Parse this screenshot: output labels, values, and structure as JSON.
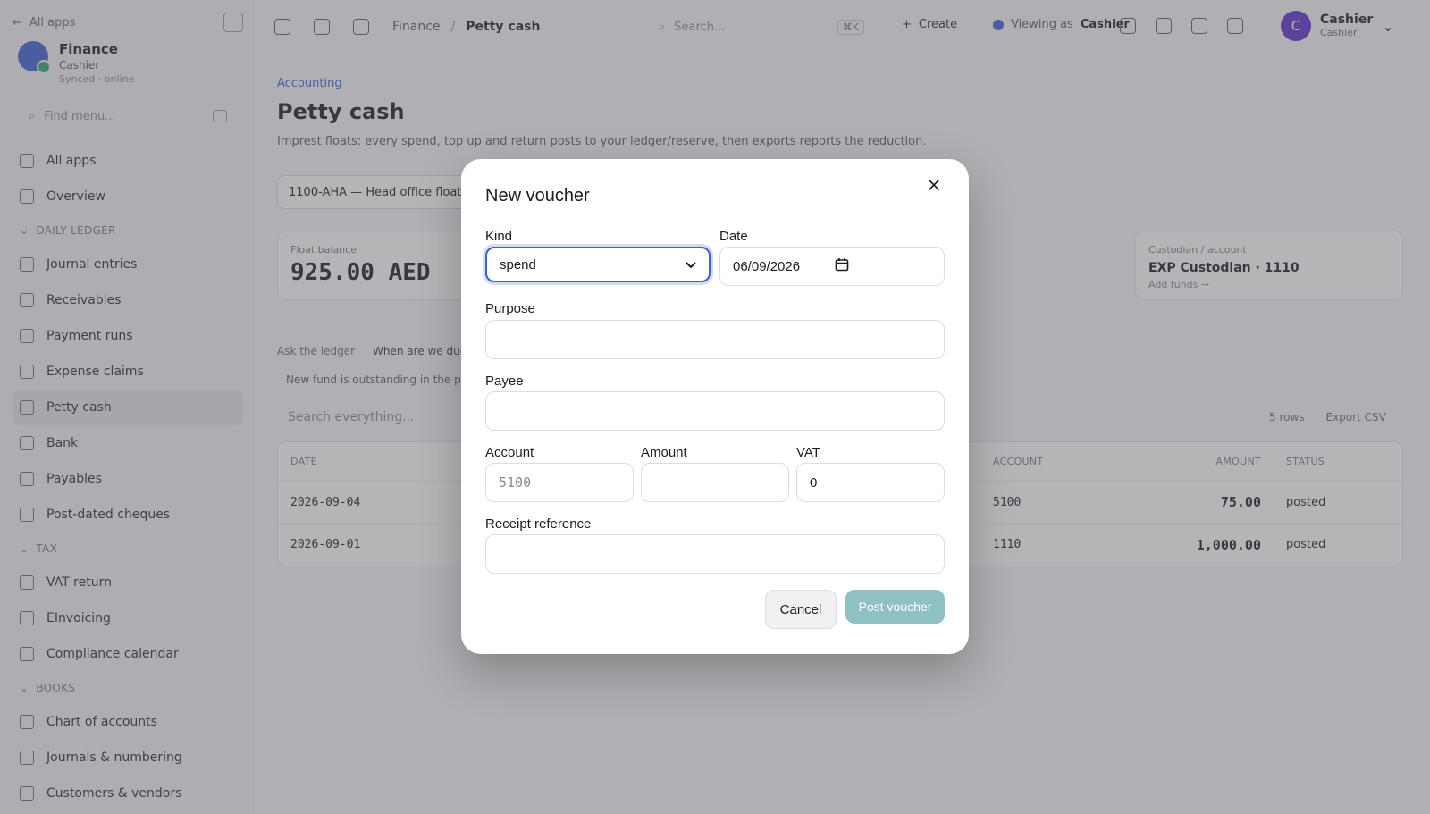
{
  "sidebar": {
    "all_apps": "All apps",
    "app": {
      "name": "Finance",
      "subtitle": "Cashier",
      "status": "Synced · online"
    },
    "search_placeholder": "Find menu...",
    "top_items": [
      {
        "label": "All apps"
      },
      {
        "label": "Overview"
      }
    ],
    "sections": [
      {
        "title": "Daily ledger",
        "items": [
          "Journal entries",
          "Receivables",
          "Payment runs",
          "Expense claims",
          "Petty cash",
          "Bank",
          "Payables",
          "Post-dated cheques"
        ]
      },
      {
        "title": "Tax",
        "items": [
          "VAT return",
          "EInvoicing",
          "Compliance calendar"
        ]
      },
      {
        "title": "Books",
        "items": [
          "Chart of accounts",
          "Journals & numbering",
          "Customers & vendors"
        ]
      }
    ],
    "active_item": "Petty cash"
  },
  "topbar": {
    "breadcrumb": [
      "Finance",
      "Petty cash"
    ],
    "search_placeholder": "Search...",
    "search_kbd": "⌘K",
    "create_label": "Create",
    "viewing_prefix": "Viewing as",
    "viewing_role": "Cashier",
    "user": {
      "initial": "C",
      "name": "Cashier",
      "role": "Cashier"
    }
  },
  "main": {
    "breadcrumb": "Accounting",
    "title": "Petty cash",
    "description": "Imprest floats: every spend, top up and return posts to your ledger/reserve, then exports reports the reduction.",
    "fund_select": "1100-AHA — Head office float",
    "kpis": [
      {
        "label": "Float balance",
        "value": "925.00 AED"
      },
      {
        "label": "Custodian / account",
        "value": "EXP Custodian · 1110",
        "sub": "Add funds →"
      }
    ],
    "ask_label": "Ask the ledger",
    "ask_question": "When are we due a reimbursement, and which vendors were paid most often in the past 30 days?",
    "note": "New fund is outstanding in the period.",
    "table_search_placeholder": "Search everything...",
    "table_actions": [
      "5 rows",
      "Export CSV"
    ],
    "table": {
      "headers": [
        "Date",
        "Account",
        "Amount",
        "Status"
      ],
      "rows": [
        {
          "date": "2026-09-04",
          "account": "5100",
          "amount": "75.00",
          "status": "posted"
        },
        {
          "date": "2026-09-01",
          "account": "1110",
          "amount": "1,000.00",
          "status": "posted"
        }
      ]
    }
  },
  "modal": {
    "title": "New voucher",
    "kind": {
      "label": "Kind",
      "value": "spend"
    },
    "date": {
      "label": "Date",
      "value": "06/09/2026"
    },
    "purpose": {
      "label": "Purpose",
      "value": ""
    },
    "payee": {
      "label": "Payee",
      "value": ""
    },
    "account": {
      "label": "Account",
      "placeholder": "5100"
    },
    "amount": {
      "label": "Amount",
      "value": ""
    },
    "vat": {
      "label": "VAT",
      "value": "0"
    },
    "receipt": {
      "label": "Receipt reference",
      "value": ""
    },
    "cancel_label": "Cancel",
    "submit_label": "Post voucher"
  },
  "colors": {
    "accent": "#3c5fd6",
    "submit_button": "#8fc0c2",
    "avatar": "#5b2fc9"
  }
}
